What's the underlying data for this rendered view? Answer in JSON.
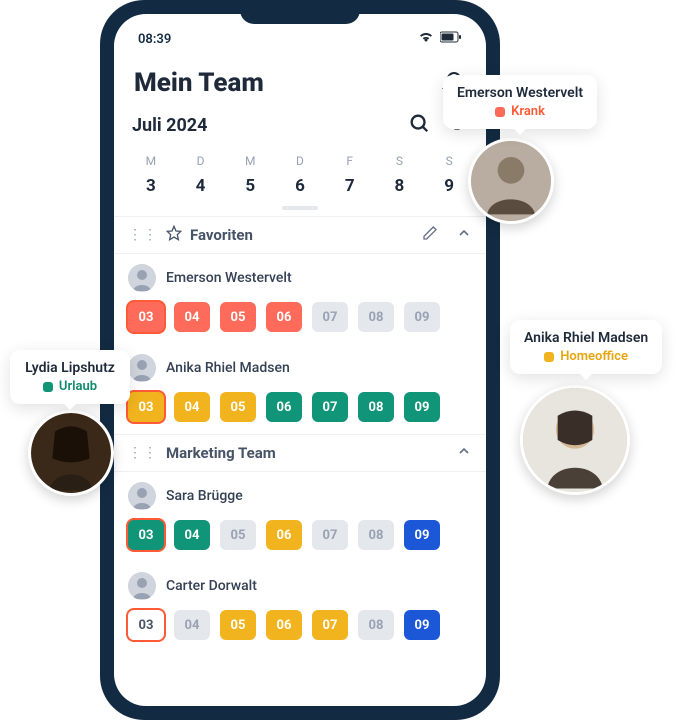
{
  "status_bar": {
    "time": "08:39"
  },
  "header": {
    "title": "Mein Team"
  },
  "month": {
    "label": "Juli 2024"
  },
  "weekdays": [
    "M",
    "D",
    "M",
    "D",
    "F",
    "S",
    "S"
  ],
  "dates": [
    "3",
    "4",
    "5",
    "6",
    "7",
    "8",
    "9"
  ],
  "sections": [
    {
      "name": "Favoriten",
      "starred": true,
      "editable": true,
      "people": [
        {
          "name": "Emerson Westervelt",
          "days": [
            {
              "label": "03",
              "color": "red",
              "today": true
            },
            {
              "label": "04",
              "color": "red"
            },
            {
              "label": "05",
              "color": "red"
            },
            {
              "label": "06",
              "color": "red"
            },
            {
              "label": "07",
              "color": "grey"
            },
            {
              "label": "08",
              "color": "grey"
            },
            {
              "label": "09",
              "color": "grey"
            }
          ]
        },
        {
          "name": "Anika Rhiel Madsen",
          "days": [
            {
              "label": "03",
              "color": "yellow",
              "today": true
            },
            {
              "label": "04",
              "color": "yellow"
            },
            {
              "label": "05",
              "color": "yellow"
            },
            {
              "label": "06",
              "color": "green"
            },
            {
              "label": "07",
              "color": "green"
            },
            {
              "label": "08",
              "color": "green"
            },
            {
              "label": "09",
              "color": "green"
            }
          ]
        }
      ]
    },
    {
      "name": "Marketing Team",
      "starred": false,
      "editable": false,
      "people": [
        {
          "name": "Sara Brügge",
          "days": [
            {
              "label": "03",
              "color": "green",
              "today": true
            },
            {
              "label": "04",
              "color": "green"
            },
            {
              "label": "05",
              "color": "grey"
            },
            {
              "label": "06",
              "color": "yellow"
            },
            {
              "label": "07",
              "color": "grey"
            },
            {
              "label": "08",
              "color": "grey"
            },
            {
              "label": "09",
              "color": "blue"
            }
          ]
        },
        {
          "name": "Carter Dorwalt",
          "days": [
            {
              "label": "03",
              "color": "white",
              "today": true
            },
            {
              "label": "04",
              "color": "grey"
            },
            {
              "label": "05",
              "color": "yellow"
            },
            {
              "label": "06",
              "color": "yellow"
            },
            {
              "label": "07",
              "color": "yellow"
            },
            {
              "label": "08",
              "color": "grey"
            },
            {
              "label": "09",
              "color": "blue"
            }
          ]
        }
      ]
    }
  ],
  "callouts": {
    "emerson": {
      "name": "Emerson Westervelt",
      "status": "Krank",
      "color": "red"
    },
    "anika": {
      "name": "Anika Rhiel Madsen",
      "status": "Homeoffice",
      "color": "yellow"
    },
    "lydia": {
      "name": "Lydia Lipshutz",
      "status": "Urlaub",
      "color": "green"
    }
  }
}
